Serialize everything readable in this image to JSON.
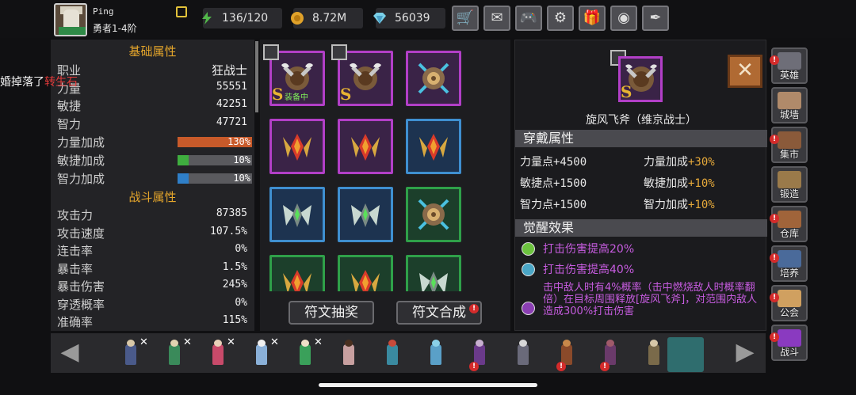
{
  "player": {
    "name": "Ping",
    "rank": "勇者1-4阶"
  },
  "resources": [
    {
      "icon": "energy-icon",
      "value": "136/120",
      "color": "#52b84a"
    },
    {
      "icon": "gold-coin-icon",
      "value": "8.72M",
      "color": "#e0a22a"
    },
    {
      "icon": "diamond-icon",
      "value": "56039",
      "color": "#7ad0e8"
    }
  ],
  "toolbar": [
    {
      "name": "shop-cart-icon",
      "glyph": "🛒"
    },
    {
      "name": "mail-icon",
      "glyph": "✉"
    },
    {
      "name": "gamepad-icon",
      "glyph": "🎮"
    },
    {
      "name": "settings-gear-icon",
      "glyph": "⚙"
    },
    {
      "name": "gift-icon",
      "glyph": "🎁"
    },
    {
      "name": "color-wheel-icon",
      "glyph": "◉"
    },
    {
      "name": "feather-icon",
      "glyph": "✒"
    }
  ],
  "stats": {
    "basic_title": "基础属性",
    "notice_prefix": "掉落了",
    "notice_item": "转生石",
    "notice_lead": "婚",
    "job_label": "职业",
    "job_value": "狂战士",
    "strength_label": "力量",
    "strength_value": "55551",
    "agility_label": "敏捷",
    "agility_value": "42251",
    "intellect_label": "智力",
    "intellect_value": "47721",
    "bonuses": [
      {
        "label": "力量加成",
        "value": "130%",
        "fill": 1.0,
        "color": "#c85a2a"
      },
      {
        "label": "敏捷加成",
        "value": "10%",
        "fill": 0.15,
        "color": "#3fae3f"
      },
      {
        "label": "智力加成",
        "value": "10%",
        "fill": 0.15,
        "color": "#2f7fc8"
      }
    ],
    "combat_title": "战斗属性",
    "combat": [
      {
        "label": "攻击力",
        "value": "87385"
      },
      {
        "label": "攻击速度",
        "value": "107.5%"
      },
      {
        "label": "连击率",
        "value": "0%"
      },
      {
        "label": "暴击率",
        "value": "1.5%"
      },
      {
        "label": "暴击伤害",
        "value": "245%"
      },
      {
        "label": "穿透概率",
        "value": "0%"
      },
      {
        "label": "准确率",
        "value": "115%"
      }
    ]
  },
  "grid": {
    "equipped_label": "装备中",
    "s_rank": "S",
    "slots": [
      {
        "name": "rune-slot-axe-1",
        "frame": "purple",
        "gem": "axe",
        "s": true,
        "equipped": true
      },
      {
        "name": "rune-slot-axe-2",
        "frame": "purple",
        "gem": "axe",
        "s": true,
        "equipped": false
      },
      {
        "name": "rune-slot-shield-1",
        "frame": "purple",
        "gem": "shield",
        "s": false,
        "equipped": false
      },
      {
        "name": "rune-slot-flame-1",
        "frame": "purple",
        "gem": "flame",
        "s": false,
        "equipped": false
      },
      {
        "name": "rune-slot-flame-2",
        "frame": "purple",
        "gem": "flame",
        "s": false,
        "equipped": false
      },
      {
        "name": "rune-slot-flame-3",
        "frame": "blue",
        "gem": "flame",
        "s": false,
        "equipped": false
      },
      {
        "name": "rune-slot-wing-1",
        "frame": "blue",
        "gem": "wing",
        "s": false,
        "equipped": false
      },
      {
        "name": "rune-slot-wing-2",
        "frame": "blue",
        "gem": "wing",
        "s": false,
        "equipped": false
      },
      {
        "name": "rune-slot-shield-2",
        "frame": "green",
        "gem": "shield",
        "s": false,
        "equipped": false
      },
      {
        "name": "rune-slot-flame-4",
        "frame": "green",
        "gem": "flame",
        "s": false,
        "equipped": false
      },
      {
        "name": "rune-slot-flame-5",
        "frame": "green",
        "gem": "flame",
        "s": false,
        "equipped": false
      },
      {
        "name": "rune-slot-wing-3",
        "frame": "green",
        "gem": "wing",
        "s": false,
        "equipped": false
      }
    ],
    "draw_button": "符文抽奖",
    "combine_button": "符文合成"
  },
  "detail": {
    "item_name": "旋风飞斧（维京战士）",
    "close_glyph": "✕",
    "wear_title": "穿戴属性",
    "attrs": [
      {
        "label": "力量点",
        "value": "+4500"
      },
      {
        "label": "力量加成",
        "value": "+30%"
      },
      {
        "label": "敏捷点",
        "value": "+1500"
      },
      {
        "label": "敏捷加成",
        "value": "+10%"
      },
      {
        "label": "智力点",
        "value": "+1500"
      },
      {
        "label": "智力加成",
        "value": "+10%"
      }
    ],
    "awaken_title": "觉醒效果",
    "awaken": [
      {
        "text": "打击伤害提高20%",
        "dot": "#6cc23f"
      },
      {
        "text": "打击伤害提高40%",
        "dot": "#4aa6c6"
      }
    ],
    "awaken3_text": "击中敌人时有4%概率（击中燃烧敌人时概率翻倍）在目标周围释放[旋风飞斧]，对范围内敌人造成300%打击伤害"
  },
  "nav": [
    {
      "label": "英雄",
      "name": "nav-hero",
      "color": "#6e6e78",
      "alert": true
    },
    {
      "label": "城墙",
      "name": "nav-wall",
      "color": "#b08a6a",
      "alert": false
    },
    {
      "label": "集市",
      "name": "nav-market",
      "color": "#8a5a3a",
      "alert": true
    },
    {
      "label": "锻造",
      "name": "nav-forge",
      "color": "#9a7a4a",
      "alert": false
    },
    {
      "label": "仓库",
      "name": "nav-storage",
      "color": "#a0643a",
      "alert": true
    },
    {
      "label": "培养",
      "name": "nav-train",
      "color": "#4a6a9a",
      "alert": true
    },
    {
      "label": "公会",
      "name": "nav-guild",
      "color": "#d0a060",
      "alert": true
    },
    {
      "label": "战斗",
      "name": "nav-battle",
      "color": "#8a3ac0",
      "alert": true
    }
  ],
  "heroes": [
    {
      "color": "#4a5a8a",
      "head": "#d8c8a8",
      "x": true,
      "alert": false
    },
    {
      "color": "#3a8a5a",
      "head": "#e2d2b0",
      "x": true,
      "alert": false
    },
    {
      "color": "#c84a6a",
      "head": "#e8d0b8",
      "x": true,
      "alert": false
    },
    {
      "color": "#8ab0d8",
      "head": "#f0f0f0",
      "x": true,
      "alert": false
    },
    {
      "color": "#3aa05a",
      "head": "#f0e0c8",
      "x": true,
      "alert": false
    },
    {
      "color": "#c8a0a0",
      "head": "#4a3020",
      "x": false,
      "alert": false
    },
    {
      "color": "#3a8aa0",
      "head": "#c84a3a",
      "x": false,
      "alert": false
    },
    {
      "color": "#5aa0c8",
      "head": "#8ad0e8",
      "x": false,
      "alert": false
    },
    {
      "color": "#6a3a8a",
      "head": "#c8b0d0",
      "x": false,
      "alert": true
    },
    {
      "color": "#6a6a7a",
      "head": "#d8d8d8",
      "x": false,
      "alert": false
    },
    {
      "color": "#8a4a2a",
      "head": "#c8884a",
      "x": false,
      "alert": true
    },
    {
      "color": "#6a3a6a",
      "head": "#a05a6a",
      "x": false,
      "alert": true
    },
    {
      "color": "#7a6a4a",
      "head": "#d8c8a8",
      "x": false,
      "alert": false
    }
  ],
  "colors": {
    "accent_gold": "#e4a52b",
    "awaken_purple": "#c75ce0",
    "highlight_red": "#e23a3a"
  }
}
